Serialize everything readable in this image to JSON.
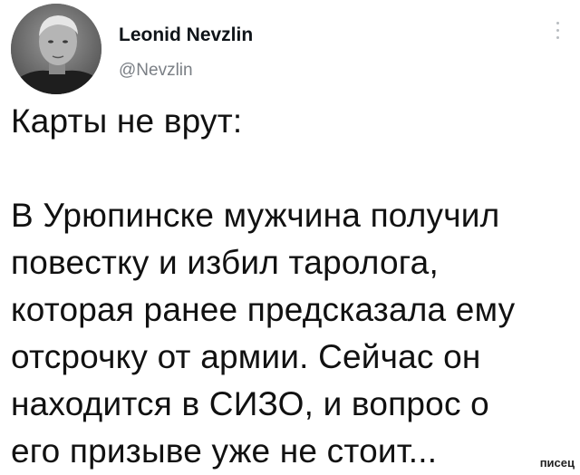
{
  "author": {
    "display_name": "Leonid Nevzlin",
    "handle": "@Nevzlin",
    "avatar_icon": "user-avatar-photo"
  },
  "menu": {
    "icon": "more-vertical-icon"
  },
  "tweet": {
    "intro": "Карты не врут:",
    "lines": [
      "В Урюпинске мужчина получил",
      "повестку и избил таролога,",
      "которая ранее предсказала ему",
      "отсрочку от армии. Сейчас он",
      "находится в СИЗО, и вопрос о",
      "его призыве уже не стоит..."
    ]
  },
  "watermark": {
    "text": "писец"
  }
}
